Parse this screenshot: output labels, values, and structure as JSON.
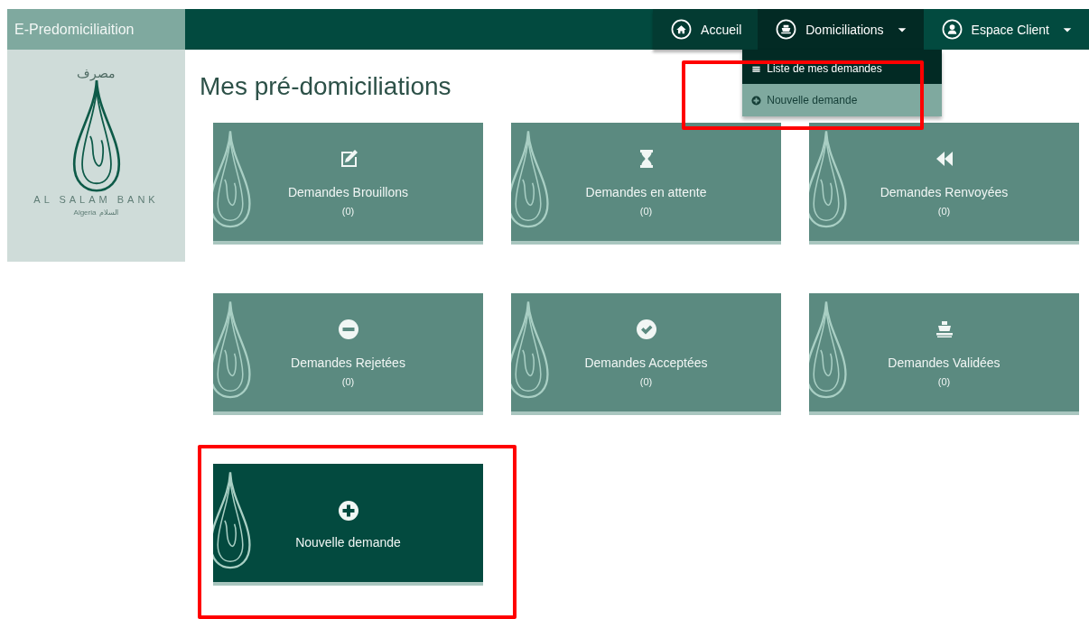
{
  "brand": "E-Predomiciliaition",
  "logo": {
    "top_text": "مصرف",
    "name": "AL SALAM BANK",
    "country": "Algeria",
    "country_arabic": "السلام"
  },
  "nav": [
    {
      "kind": "link",
      "label": "Accueil",
      "selected": true
    },
    {
      "kind": "menu",
      "label": "Domiciliations",
      "selected": false,
      "expanded": true,
      "menu": [
        {
          "label": "Liste de mes demandes",
          "selected": false
        },
        {
          "label": "Nouvelle demande",
          "selected": true
        }
      ]
    },
    {
      "kind": "menu",
      "label": "Espace Client",
      "selected": false,
      "expanded": false
    }
  ],
  "title": "Mes pré-domiciliations",
  "tiles": [
    {
      "kind": "status",
      "label": "Demandes Brouillons",
      "count": "(0)"
    },
    {
      "kind": "status",
      "label": "Demandes en attente",
      "count": "(0)"
    },
    {
      "kind": "status",
      "label": "Demandes Renvoyées",
      "count": "(0)"
    },
    {
      "kind": "status",
      "label": "Demandes Rejetées",
      "count": "(0)"
    },
    {
      "kind": "status",
      "label": "Demandes Acceptées",
      "count": "(0)"
    },
    {
      "kind": "status",
      "label": "Demandes Validées",
      "count": "(0)"
    },
    {
      "kind": "action",
      "label": "Nouvelle demande"
    }
  ]
}
